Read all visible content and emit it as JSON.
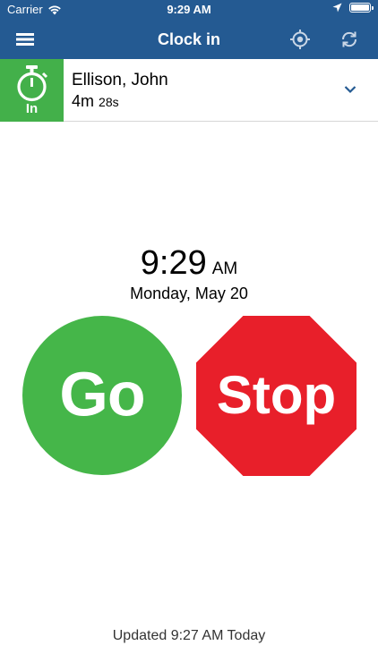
{
  "status_bar": {
    "carrier": "Carrier",
    "time": "9:29 AM",
    "icons": [
      "wifi-icon",
      "location-arrow-icon",
      "battery-icon"
    ]
  },
  "nav": {
    "title": "Clock in",
    "icons": [
      "menu-icon",
      "locate-icon",
      "sync-icon"
    ],
    "color": "#245a92"
  },
  "user": {
    "status_label": "In",
    "status_color": "#43b04a",
    "name": "Ellison, John",
    "duration_min": "4m",
    "duration_sec": "28s"
  },
  "clock": {
    "time": "9:29",
    "ampm": "AM",
    "date": "Monday, May 20"
  },
  "actions": {
    "go_label": "Go",
    "go_color": "#45b649",
    "stop_label": "Stop",
    "stop_color": "#e81f2a"
  },
  "footer": {
    "updated": "Updated 9:27 AM Today"
  }
}
